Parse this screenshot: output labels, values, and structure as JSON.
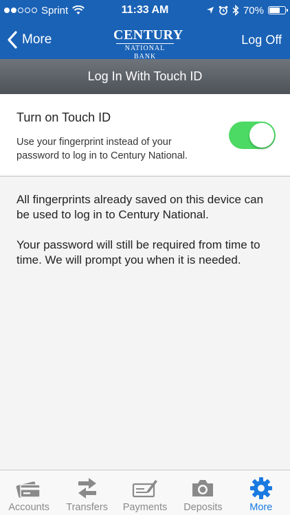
{
  "status_bar": {
    "carrier": "Sprint",
    "time": "11:33 AM",
    "battery_percent": "70%",
    "battery_level": 0.7,
    "signal_bars_filled": 2,
    "signal_bars_total": 5
  },
  "nav": {
    "back_label": "More",
    "logo_top": "CENTURY",
    "logo_bottom": "NATIONAL BANK",
    "logoff_label": "Log Off"
  },
  "section_header": {
    "title": "Log In With Touch ID"
  },
  "touch_id": {
    "title": "Turn on Touch ID",
    "description": "Use your fingerprint instead of your password to log in to Century National.",
    "enabled": true
  },
  "info": {
    "paragraph_1": "All fingerprints already saved on this device can be used to log in to Century National.",
    "paragraph_2": "Your password will still be required from time to time. We will prompt you when it is needed."
  },
  "tab_bar": {
    "tabs": [
      {
        "label": "Accounts",
        "icon": "credit-card-icon"
      },
      {
        "label": "Transfers",
        "icon": "transfer-arrows-icon"
      },
      {
        "label": "Payments",
        "icon": "check-pen-icon"
      },
      {
        "label": "Deposits",
        "icon": "camera-icon"
      },
      {
        "label": "More",
        "icon": "gear-icon"
      }
    ],
    "active_index": 4
  },
  "colors": {
    "brand_blue": "#1a62b6",
    "toggle_on": "#4cd964",
    "active_tab": "#1a7ae0",
    "inactive_tab": "#8a8a8a"
  }
}
